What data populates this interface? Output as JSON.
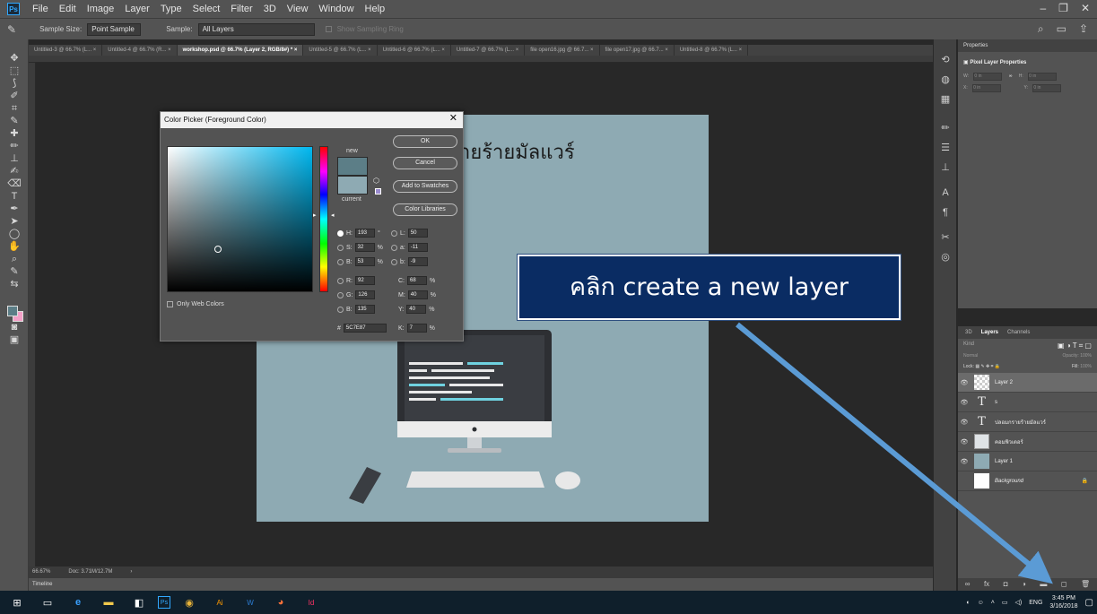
{
  "menu": [
    "File",
    "Edit",
    "Image",
    "Layer",
    "Type",
    "Select",
    "Filter",
    "3D",
    "View",
    "Window",
    "Help"
  ],
  "options_bar": {
    "sample_size_label": "Sample Size:",
    "sample_size_value": "Point Sample",
    "sample_label": "Sample:",
    "sample_value": "All Layers",
    "show_ring": "Show Sampling Ring"
  },
  "tabs": [
    "Untitled-3 @ 66.7% (L... ×",
    "Untitled-4 @ 66.7% (R... ×",
    "workshop.psd @ 66.7% (Layer 2, RGB/8#) * ×",
    "Untitled-5 @ 66.7% (L... ×",
    "Untitled-6 @ 66.7% (L... ×",
    "Untitled-7 @ 66.7% (L... ×",
    "file open16.jpg @ 66.7... ×",
    "file open17.jpg @ 66.7... ×",
    "Untitled-8 @ 66.7% (L... ×"
  ],
  "active_tab_index": 2,
  "document": {
    "title_text": "ายร้ายมัลแวร์",
    "bg_color": "#8eaab3"
  },
  "status": {
    "zoom": "66.67%",
    "doc_size": "Doc: 3.71M/12.7M"
  },
  "timeline_label": "Timeline",
  "properties": {
    "header": "Properties",
    "subtitle": "Pixel Layer Properties",
    "w_label": "W:",
    "h_label": "H:",
    "x_label": "X:",
    "y_label": "Y:",
    "w_value": "0 in",
    "h_value": "0 in",
    "x_value": "0 in",
    "y_value": "0 in"
  },
  "layers_panel": {
    "tabs": [
      "3D",
      "Layers",
      "Channels"
    ],
    "active_tab": "Layers",
    "kind_placeholder": "Kind",
    "blend_mode": "Normal",
    "opacity_label": "Opacity:",
    "opacity_value": "100%",
    "lock_label": "Lock:",
    "fill_label": "Fill:",
    "fill_value": "100%",
    "layers": [
      {
        "name": "Layer 2",
        "type": "pixel",
        "thumb": "transparent",
        "selected": true
      },
      {
        "name": "s",
        "type": "text",
        "thumb": "T",
        "selected": false
      },
      {
        "name": "ปลอมกรายร้ายมัลแวร์",
        "type": "text",
        "thumb": "T",
        "selected": false
      },
      {
        "name": "คอมพิวเตอร์",
        "type": "pixel",
        "thumb": "image",
        "selected": false
      },
      {
        "name": "Layer 1",
        "type": "pixel",
        "thumb": "#8eaab3",
        "selected": false
      },
      {
        "name": "Background",
        "type": "pixel",
        "thumb": "#ffffff",
        "selected": false
      }
    ]
  },
  "color_picker": {
    "title": "Color Picker (Foreground Color)",
    "new_label": "new",
    "current_label": "current",
    "new_color": "#5c7e87",
    "current_color": "#8eaab3",
    "buttons": {
      "ok": "OK",
      "cancel": "Cancel",
      "add_swatches": "Add to Swatches",
      "libraries": "Color Libraries"
    },
    "fields": {
      "H": "193",
      "S": "32",
      "B": "53",
      "R": "92",
      "G": "126",
      "B2": "135",
      "L": "50",
      "a": "-11",
      "b": "-9",
      "C": "68",
      "M": "40",
      "Y": "40",
      "K": "7"
    },
    "hex": "5C7E87",
    "only_web_colors": "Only Web Colors",
    "deg": "°",
    "pct": "%",
    "hash": "#"
  },
  "callout": {
    "text": "คลิก create a new layer"
  },
  "taskbar": {
    "time": "3:45 PM",
    "date": "3/16/2018",
    "lang": "ENG"
  }
}
